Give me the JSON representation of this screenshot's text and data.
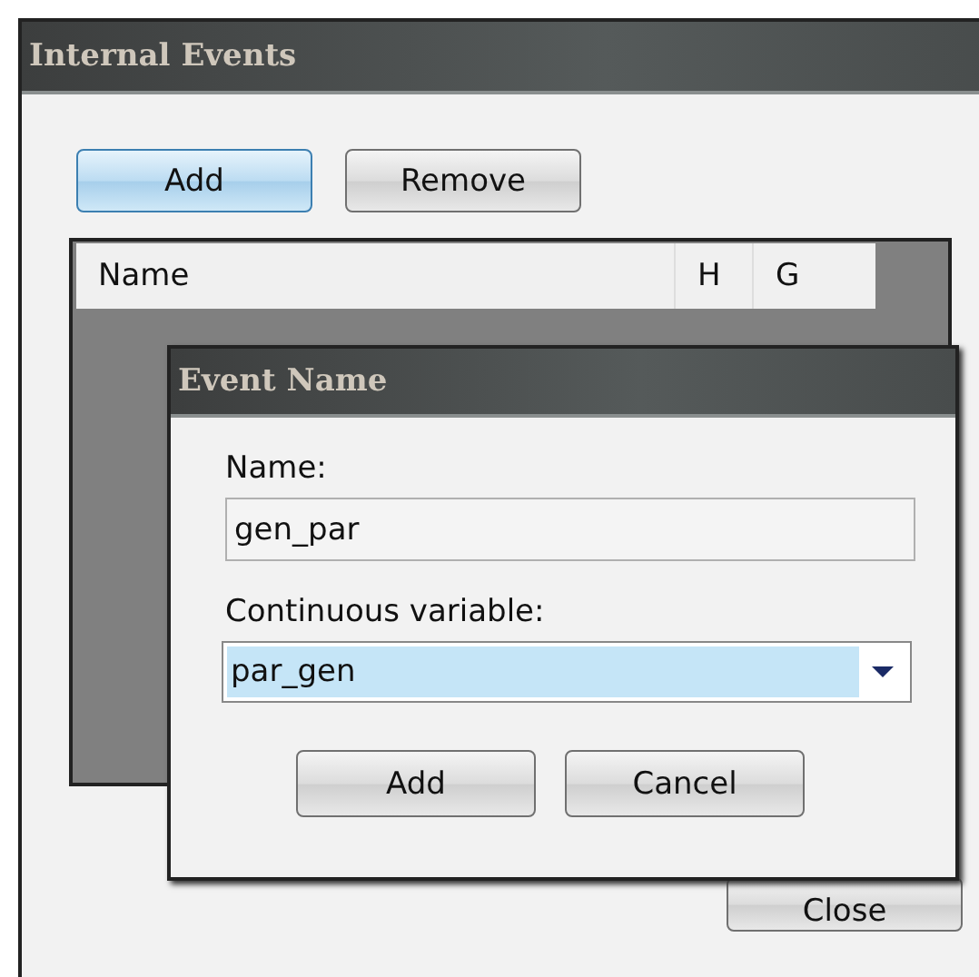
{
  "window": {
    "title": "Internal Events"
  },
  "toolbar_buttons": [
    {
      "label": "Add",
      "default": true
    },
    {
      "label": "Remove",
      "default": false
    }
  ],
  "table": {
    "columns": [
      "Name",
      "H",
      "G"
    ]
  },
  "close_button": {
    "label": "Close"
  },
  "dialog": {
    "title": "Event Name",
    "name_field": {
      "label": "Name:",
      "value": "gen_par"
    },
    "variable_combo": {
      "label": "Continuous variable:",
      "value": "par_gen",
      "selected": true
    },
    "buttons": [
      {
        "label": "Add",
        "default": false
      },
      {
        "label": "Cancel",
        "default": false
      }
    ]
  }
}
